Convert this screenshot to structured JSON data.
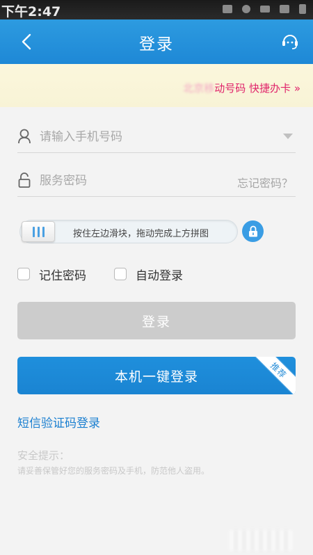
{
  "status_bar": {
    "time": "下午2:47"
  },
  "header": {
    "title": "登录"
  },
  "promo": {
    "prefix_blurred": "北京移",
    "text": "动号码 快捷办卡",
    "chevron": "»"
  },
  "phone_field": {
    "placeholder": "请输入手机号码",
    "value": ""
  },
  "password_field": {
    "placeholder": "服务密码",
    "value": "",
    "forgot_label": "忘记密码？"
  },
  "slider": {
    "hint": "按住左边滑块，拖动完成上方拼图",
    "progress": 0
  },
  "options": {
    "remember_label": "记住密码",
    "auto_login_label": "自动登录"
  },
  "buttons": {
    "login_label": "登录",
    "one_key_label": "本机一键登录",
    "recommend_badge": "推荐"
  },
  "sms_login_label": "短信验证码登录",
  "security_tip": {
    "title": "安全提示：",
    "text": "请妥善保管好您的服务密码及手机，防范他人盗用。"
  },
  "colors": {
    "brand_blue": "#1e88d6",
    "promo_pink": "#e0226a",
    "disabled_gray": "#cccccc"
  },
  "icons": [
    "back-arrow-icon",
    "customer-service-icon",
    "person-icon",
    "lock-icon",
    "padlock-icon",
    "slider-grip-icon"
  ]
}
